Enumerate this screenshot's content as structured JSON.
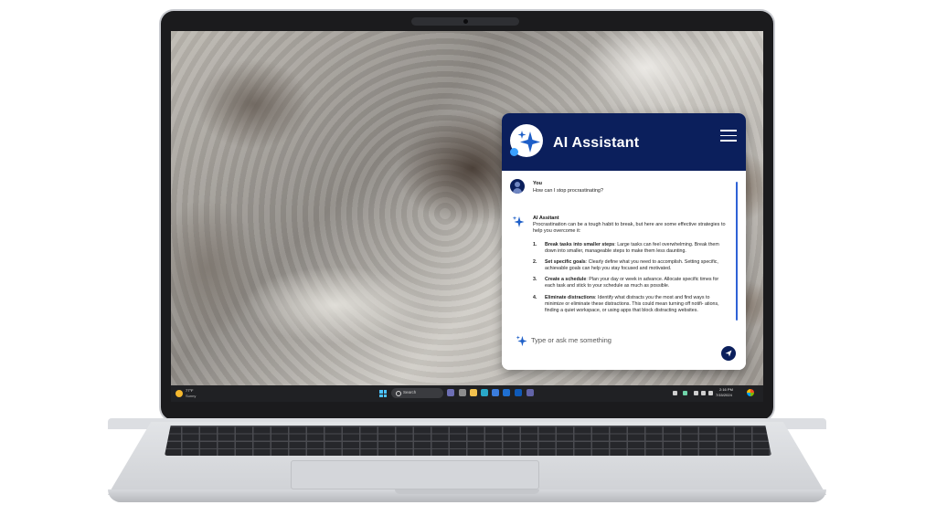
{
  "assistant": {
    "title": "AI Assistant",
    "menu_icon": "hamburger-menu-icon",
    "logo_icon": "sparkle-icon",
    "user": {
      "name": "You",
      "message": "How can I stop procrastinating?"
    },
    "ai": {
      "name": "AI Assitant",
      "intro": "Procrastination can be a tough habit to break, but here are some effective strategies to help you overcome it:",
      "steps": [
        {
          "num": "1.",
          "title": "Break tasks into smaller steps",
          "text": ": Large tasks can feel overwhelming. Break them down into smaller, manageable steps to make them less daunting."
        },
        {
          "num": "2.",
          "title": "Set specific goals",
          "text": ": Clearly define what you need to accomplish. Setting specific, achievable goals can help you stay focused and motivated."
        },
        {
          "num": "3.",
          "title": "Create a schedule",
          "text": ": Plan your day or week in advance. Allocate specific times for each task and stick to your schedule as much as possible."
        },
        {
          "num": "4.",
          "title": "Eliminate distractions",
          "text": ": Identify what distracts you the most and find ways to minimize or eliminate these distractions. This could mean turning off notifi- ations, finding a quiet workspace, or using apps that block distracting websites."
        }
      ]
    },
    "input": {
      "placeholder": "Type or ask me something",
      "value": ""
    },
    "send_icon": "send-icon",
    "colors": {
      "header": "#0b1f5c",
      "accent": "#2f62d6",
      "sparkle": "#1e5fc8"
    }
  },
  "taskbar": {
    "weather": {
      "temp": "77°F",
      "desc": "Sunny"
    },
    "search_label": "Search",
    "clock": {
      "time": "2:16 PM",
      "date": "7/15/2024"
    }
  }
}
